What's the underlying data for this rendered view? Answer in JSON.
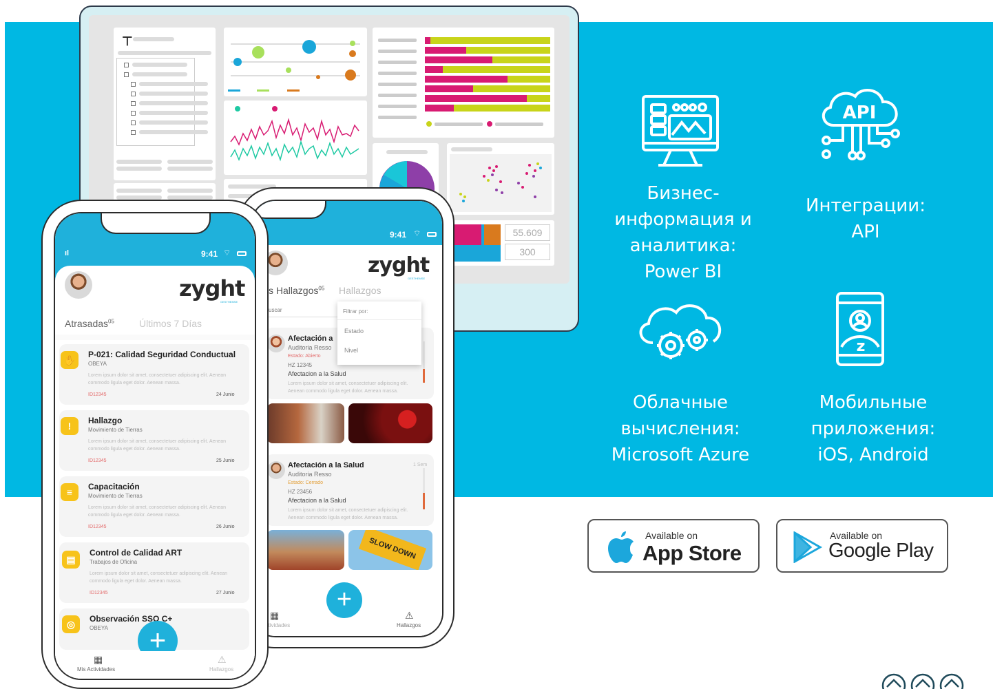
{
  "colors": {
    "band": "#00b8e3",
    "accent_blue": "#1fb1db",
    "icon_yellow": "#f7c31a",
    "magenta": "#d81b72",
    "lime": "#c8d41a",
    "orange": "#d97a1e"
  },
  "dashboard": {
    "kpi_1": "55.609",
    "kpi_2": "300"
  },
  "features": [
    {
      "label": "Бизнес-\nинформация и\nаналитика:\nPower BI",
      "icon": "monitor-analytics-icon"
    },
    {
      "label": "Интеграции:\nAPI",
      "icon": "cloud-api-icon",
      "icon_text": "API"
    },
    {
      "label": "Облачные\nвычисления:\nMicrosoft Azure",
      "icon": "cloud-gears-icon"
    },
    {
      "label": "Мобильные\nприложения:\niOS, Android",
      "icon": "mobile-app-icon",
      "icon_text": "z"
    }
  ],
  "badges": {
    "app_store": {
      "small": "Available on",
      "big": "App Store"
    },
    "google_play": {
      "small": "Available on",
      "big": "Google Play"
    }
  },
  "phone_front": {
    "time": "9:41",
    "logo": "zyght",
    "logo_sub": "GESTHEMSE",
    "tab_1": "Atrasadas",
    "tab_1_count": "05",
    "tab_2": "Últimos 7 Días",
    "cards": [
      {
        "title": "P-021: Calidad Seguridad Conductual",
        "sub": "OBEYA",
        "lorem": "Lorem ipsum dolor sit amet, consectetuer adipiscing elit. Aenean commodo ligula eget dolor. Aenean massa.",
        "id": "ID12345",
        "date": "24 Junio",
        "icon": "hand-icon"
      },
      {
        "title": "Hallazgo",
        "sub": "Movimiento de Tierras",
        "lorem": "Lorem ipsum dolor sit amet, consectetuer adipiscing elit. Aenean commodo ligula eget dolor. Aenean massa.",
        "id": "ID12345",
        "date": "25 Junio",
        "icon": "warning-icon"
      },
      {
        "title": "Capacitación",
        "sub": "Movimiento de Tierras",
        "lorem": "Lorem ipsum dolor sit amet, consectetuer adipiscing elit. Aenean commodo ligula eget dolor. Aenean massa.",
        "id": "ID12345",
        "date": "26 Junio",
        "icon": "chat-icon"
      },
      {
        "title": "Control de Calidad ART",
        "sub": "Trabajos de Oficina",
        "lorem": "Lorem ipsum dolor sit amet, consectetuer adipiscing elit. Aenean commodo ligula eget dolor. Aenean massa.",
        "id": "ID12345",
        "date": "27 Junio",
        "icon": "clipboard-icon"
      },
      {
        "title": "Observación SSO C+",
        "sub": "OBEYA",
        "icon": "target-icon"
      }
    ],
    "nav_left": "Mis Actividades",
    "nav_right": "Hallazgos",
    "fab": "+"
  },
  "phone_back": {
    "time": "9:41",
    "logo": "zyght",
    "logo_sub": "GESTHEMSE",
    "tab_1": "s Hallazgos",
    "tab_1_count": "05",
    "tab_2": "Hallazgos",
    "search_placeholder": "uscar",
    "filter_label": "Filtrar por:",
    "filter_opt_1": "Estado",
    "filter_opt_2": "Nivel",
    "card_1": {
      "title": "Afectación a",
      "sub": "Auditoria Resso",
      "status": "Estado: Abierto",
      "hz": "HZ 12345",
      "detail": "Afectacion a la Salud",
      "lorem": "Lorem ipsum dolor sit amet, consectetuer adipiscing elit. Aenean commodo ligula eget dolor. Aenean massa."
    },
    "card_2": {
      "title": "Afectación a la Salud",
      "sub": "Auditoria Resso",
      "status": "Estado: Cerrado",
      "hz": "HZ 23456",
      "detail": "Afectacion a la Salud",
      "time": "1 Sem",
      "lorem": "Lorem ipsum dolor sit amet, consectetuer adipiscing elit. Aenean commodo ligula eget dolor. Aenean massa."
    },
    "sign_text": "SLOW DOWN",
    "nav_left": "Mis Actividades",
    "nav_right": "Hallazgos",
    "fab": "+"
  }
}
